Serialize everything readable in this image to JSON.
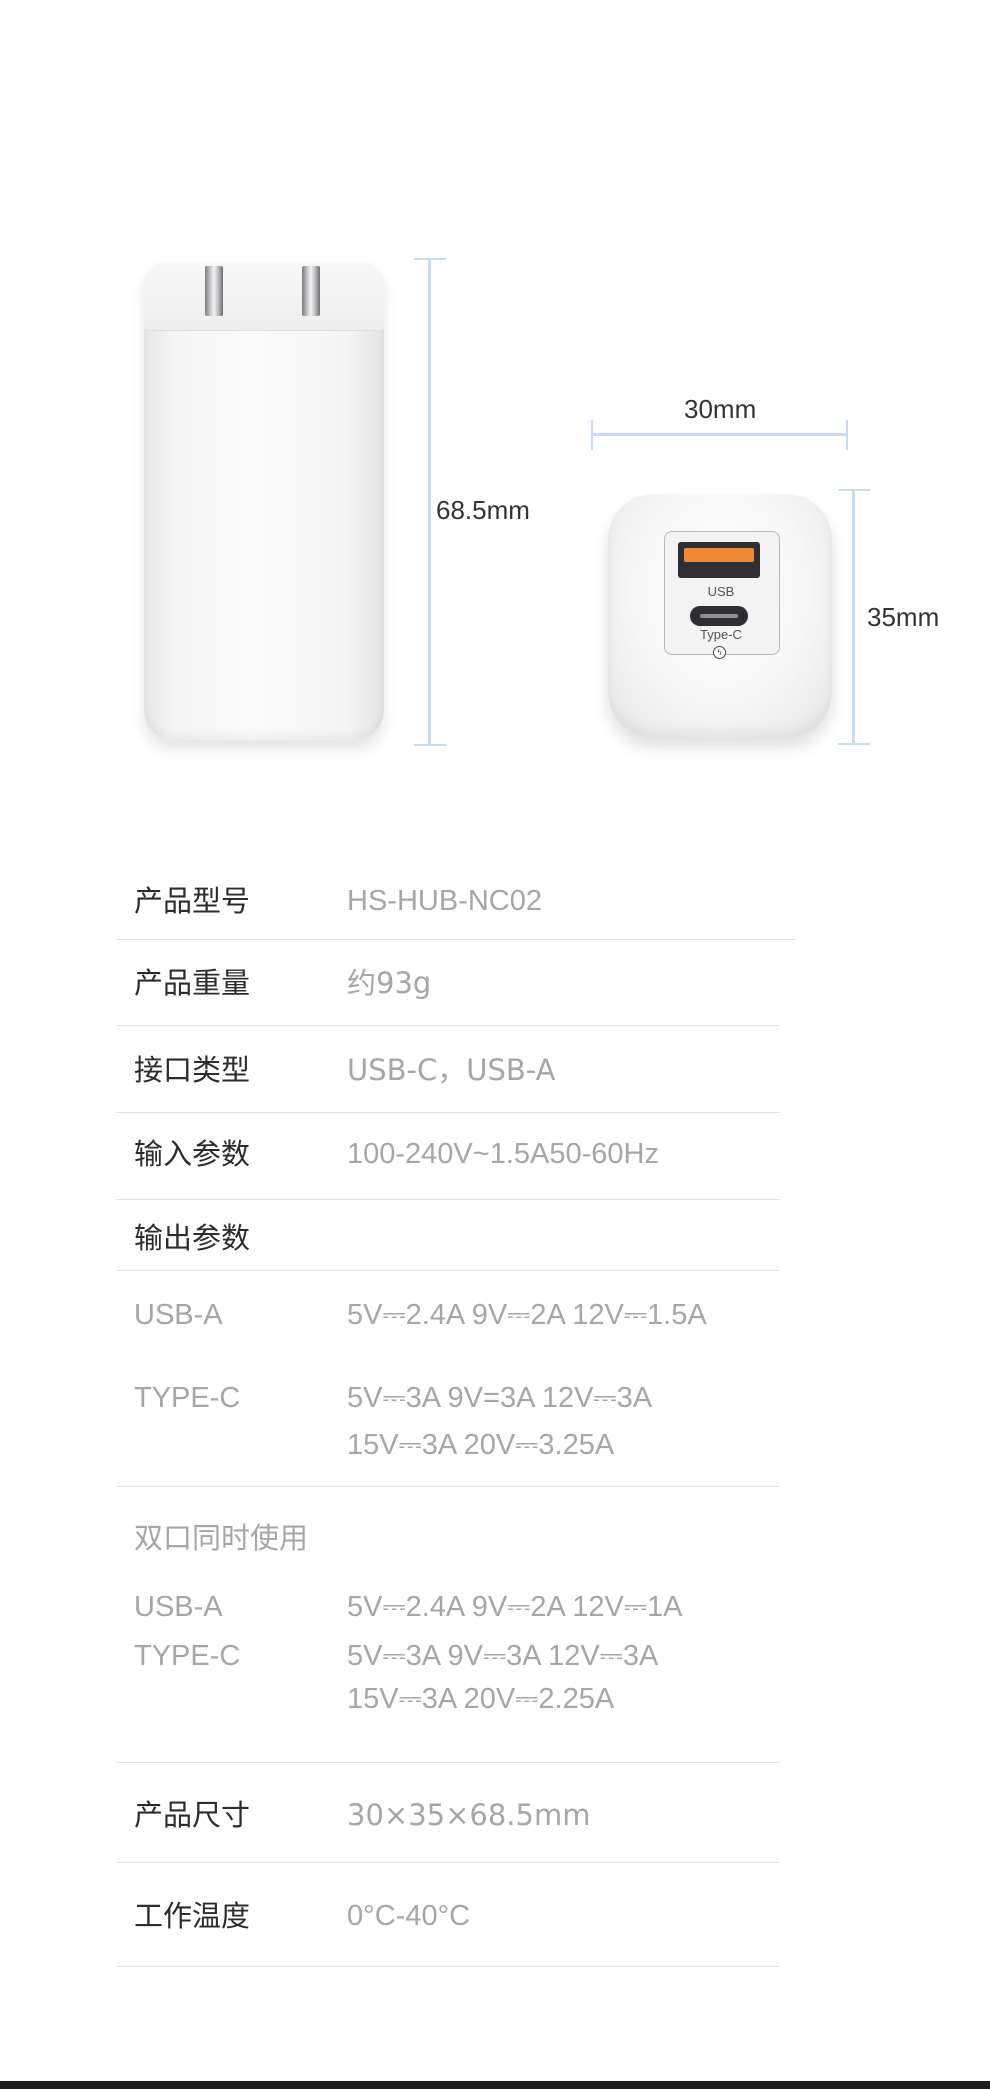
{
  "dimensions": {
    "height": "68.5mm",
    "width": "30mm",
    "depth": "35mm"
  },
  "ports": {
    "usb_label": "USB",
    "typec_label": "Type-C"
  },
  "specs": {
    "model": {
      "label": "产品型号",
      "value": "HS-HUB-NC02"
    },
    "weight": {
      "label": "产品重量",
      "value": "约93g"
    },
    "interface": {
      "label": "接口类型",
      "value": "USB-C，USB-A"
    },
    "input": {
      "label": "输入参数",
      "value": "100-240V~1.5A50-60Hz"
    },
    "output": {
      "label": "输出参数",
      "usb_a": {
        "label": "USB-A",
        "value": "5V⎓2.4A 9V⎓2A 12V⎓1.5A"
      },
      "type_c": {
        "label": "TYPE-C",
        "value_line1": "5V⎓3A 9V=3A 12V⎓3A",
        "value_line2": "15V⎓3A  20V⎓3.25A"
      }
    },
    "dual": {
      "label": "双口同时使用",
      "usb_a": {
        "label": "USB-A",
        "value": "5V⎓2.4A 9V⎓2A 12V⎓1A"
      },
      "type_c": {
        "label": "TYPE-C",
        "value_line1": "5V⎓3A 9V⎓3A 12V⎓3A",
        "value_line2": "15V⎓3A 20V⎓2.25A"
      }
    },
    "size": {
      "label": "产品尺寸",
      "value": "30×35×68.5mm"
    },
    "temperature": {
      "label": "工作温度",
      "value": "0°C-40°C"
    }
  }
}
